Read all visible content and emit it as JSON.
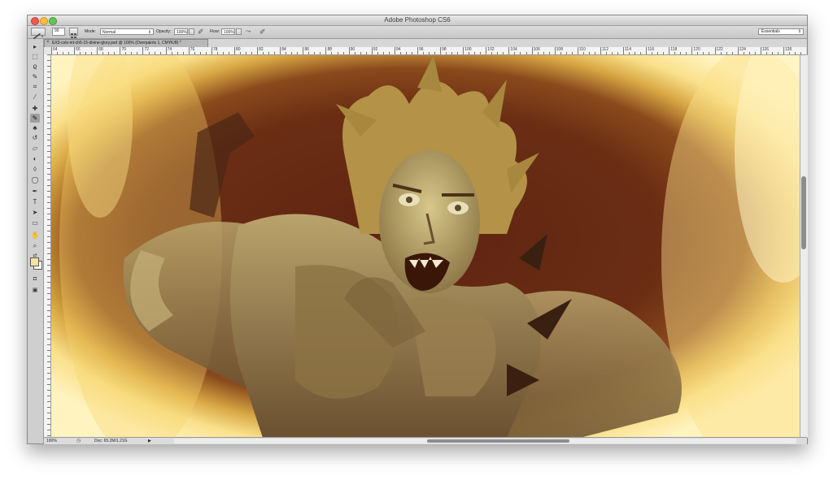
{
  "app": {
    "title": "Adobe Photoshop CS6"
  },
  "options_bar": {
    "mode_label": "Mode:",
    "mode_value": "Normal",
    "opacity_label": "Opacity:",
    "opacity_value": "100%",
    "flow_label": "Flow:",
    "flow_value": "100%",
    "workspace": "Essentials",
    "brush_size": "90"
  },
  "document": {
    "tab_title": "EX3-cols-int-ch5-15-divine-glory.psd @ 100% (Overpaints 1, CMYK/8) *"
  },
  "ruler": {
    "ticks": [
      "64",
      "66",
      "68",
      "70",
      "72",
      "74",
      "76",
      "78",
      "80",
      "82",
      "84",
      "86",
      "88",
      "90",
      "92",
      "94",
      "96",
      "98",
      "100",
      "102",
      "104",
      "106",
      "108",
      "110",
      "112",
      "114",
      "116",
      "118",
      "120",
      "122",
      "124",
      "126",
      "128"
    ]
  },
  "status": {
    "zoom": "100%",
    "doc_size": "Doc: 65.2M/1.21G"
  },
  "tools": [
    "move-tool",
    "marquee-tool",
    "lasso-tool",
    "quick-select-tool",
    "crop-tool",
    "eyedropper-tool",
    "healing-brush-tool",
    "brush-tool",
    "clone-stamp-tool",
    "history-brush-tool",
    "eraser-tool",
    "gradient-tool",
    "blur-tool",
    "dodge-tool",
    "pen-tool",
    "type-tool",
    "path-select-tool",
    "shape-tool",
    "hand-tool",
    "zoom-tool"
  ],
  "colors": {
    "foreground": "#f3e3a0",
    "background": "#ffffff"
  }
}
